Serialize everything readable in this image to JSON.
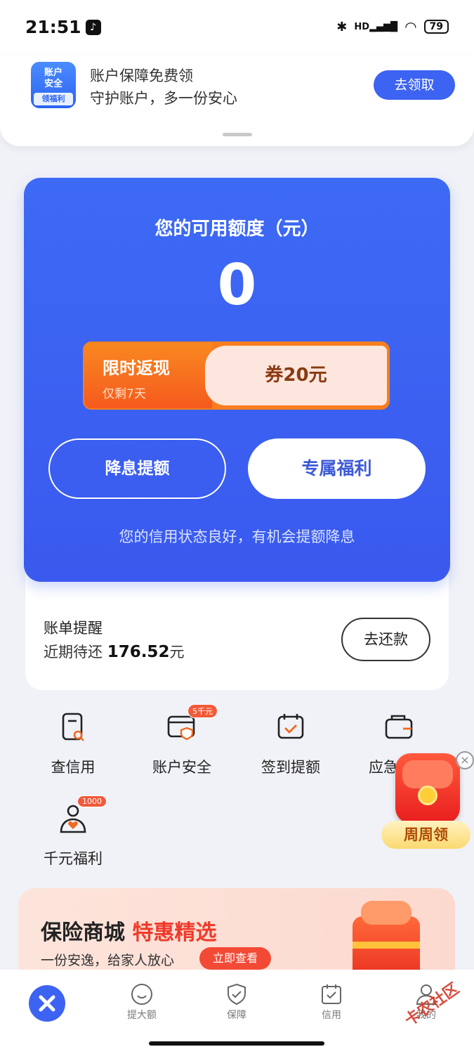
{
  "status_bar": {
    "time": "21:51",
    "network": "HD",
    "battery": "79"
  },
  "top_banner": {
    "icon_line1": "账户",
    "icon_line2": "安全",
    "icon_tag": "领福利",
    "title": "账户保障免费领",
    "subtitle": "守护账户，多一份安心",
    "button": "去领取"
  },
  "credit_card": {
    "title": "您的可用额度（元）",
    "amount": "0",
    "promo": {
      "label": "限时返现",
      "days_left": "仅剩7天",
      "coupon": "券20元"
    },
    "btn_reduce": "降息提额",
    "btn_exclusive": "专属福利",
    "note": "您的信用状态良好，有机会提额降息"
  },
  "bill": {
    "title": "账单提醒",
    "prefix": "近期待还",
    "amount": "176.52",
    "unit": "元",
    "button": "去还款"
  },
  "grid": [
    {
      "label": "查信用",
      "icon": "credit-check-icon"
    },
    {
      "label": "账户安全",
      "icon": "account-security-icon",
      "badge": "5千元"
    },
    {
      "label": "签到提额",
      "icon": "calendar-check-icon"
    },
    {
      "label": "应急额",
      "icon": "wallet-icon"
    },
    {
      "label": "千元福利",
      "icon": "heart-person-icon",
      "badge": "1000"
    }
  ],
  "float_ad": {
    "label": "周周领",
    "close": "×"
  },
  "insurance": {
    "title": "保险商城",
    "highlight": "特惠精选",
    "subtitle": "一份安逸，给家人放心",
    "button": "立即查看"
  },
  "nav": [
    {
      "label": "提大额"
    },
    {
      "label": "保障"
    },
    {
      "label": "信用"
    },
    {
      "label": "我的"
    }
  ],
  "watermark": "卡农社区",
  "colors": {
    "primary": "#3d63f2",
    "orange": "#f97d1e",
    "red": "#f34a36"
  }
}
